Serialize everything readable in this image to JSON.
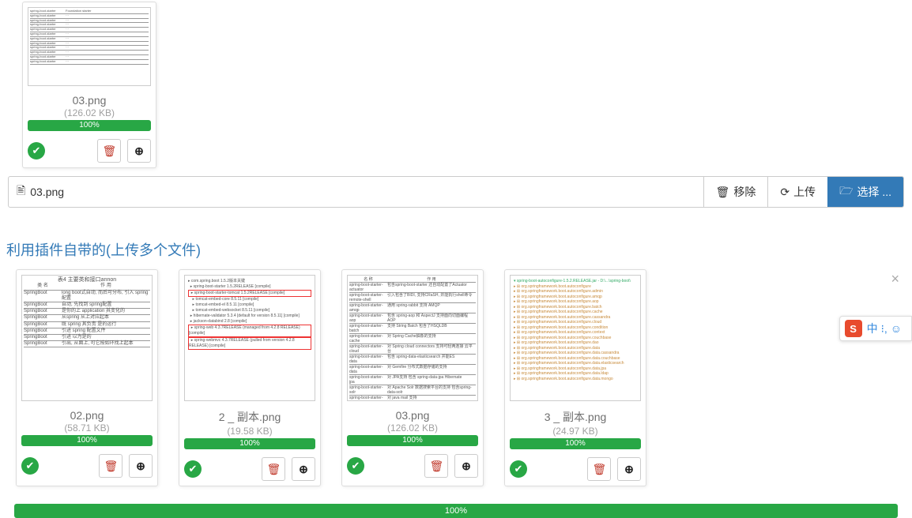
{
  "top_card": {
    "filename": "03.png",
    "filesize": "(126.02 KB)",
    "progress_label": "100%",
    "progress_pct": 100
  },
  "file_input": {
    "filename": "03.png",
    "remove_label": "移除",
    "upload_label": "上传",
    "select_label": "选择 ..."
  },
  "section_title": "利用插件自带的(上传多个文件)",
  "cards": [
    {
      "filename": "02.png",
      "filesize": "(58.71 KB)",
      "progress_label": "100%",
      "progress_pct": 100,
      "thumb_type": "table"
    },
    {
      "filename": "2 _ 副本.png",
      "filesize": "(19.58 KB)",
      "progress_label": "100%",
      "progress_pct": 100,
      "thumb_type": "tree"
    },
    {
      "filename": "03.png",
      "filesize": "(126.02 KB)",
      "progress_label": "100%",
      "progress_pct": 100,
      "thumb_type": "table2"
    },
    {
      "filename": "3 _ 副本.png",
      "filesize": "(24.97 KB)",
      "progress_label": "100%",
      "progress_pct": 100,
      "thumb_type": "list"
    }
  ],
  "overall_progress": {
    "label": "100%",
    "pct": 100
  },
  "floater": {
    "badge": "S",
    "text": "中 ⁝, ☺"
  }
}
